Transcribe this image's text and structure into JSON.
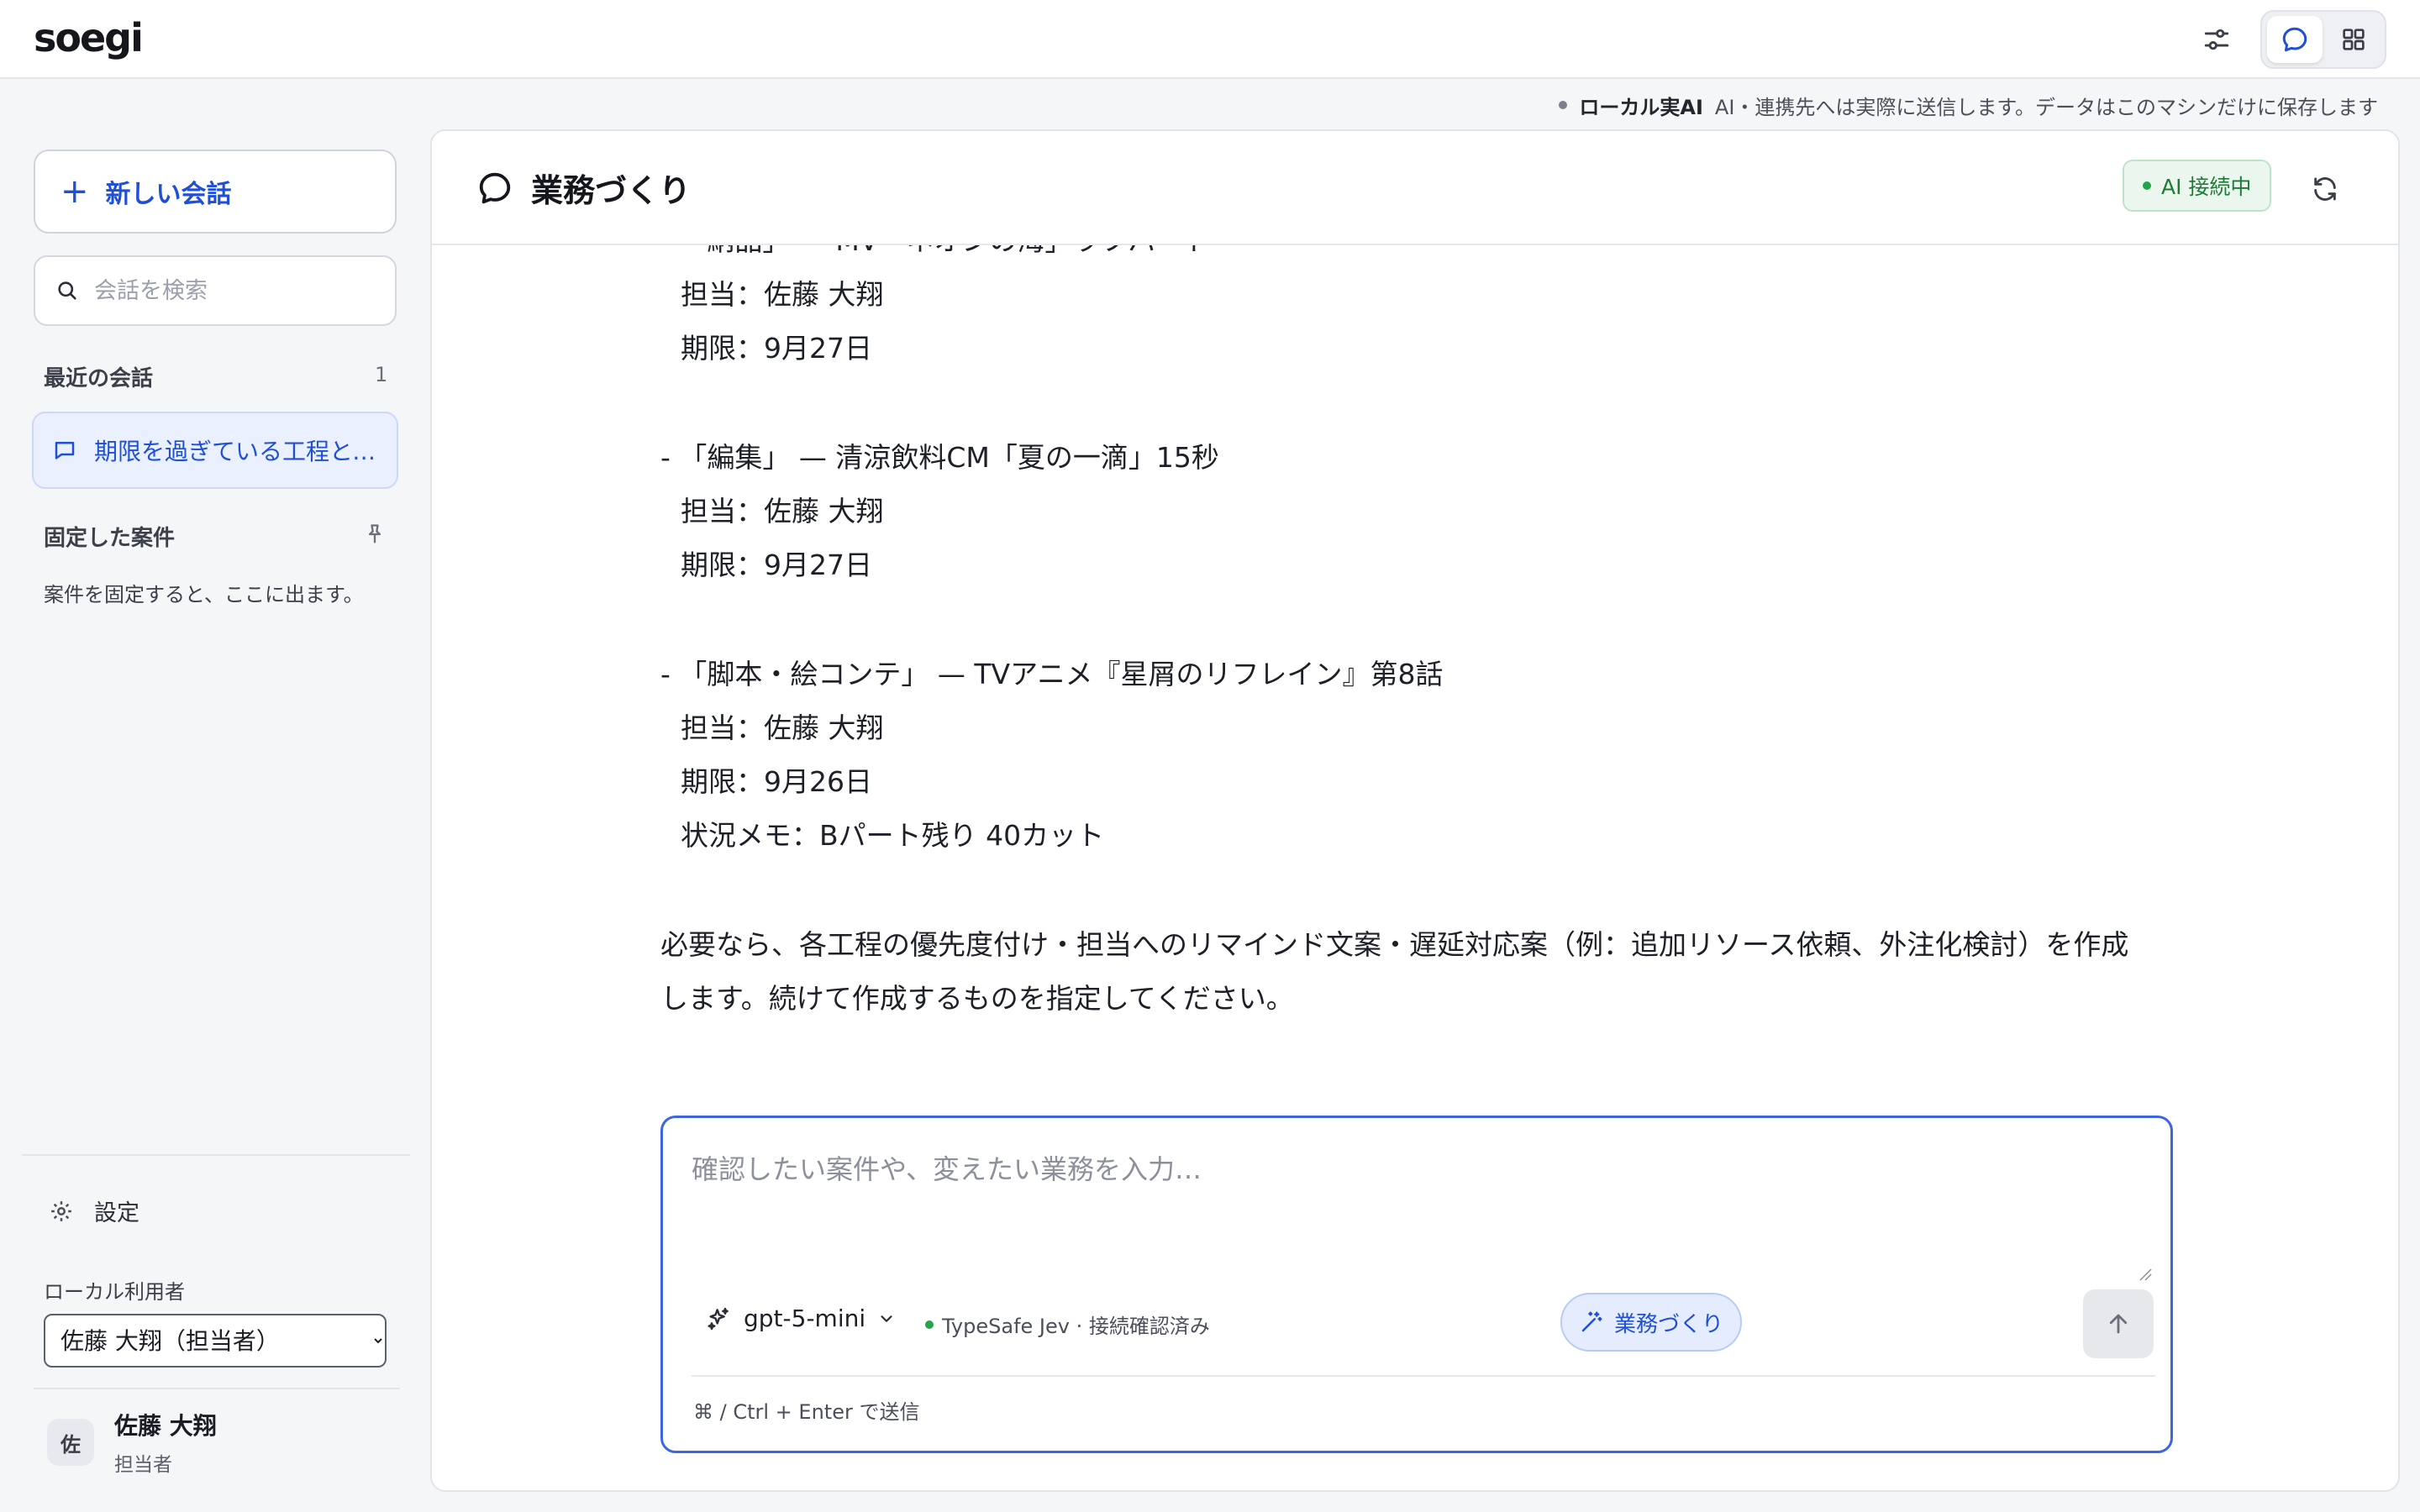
{
  "app": {
    "logo": "soegi"
  },
  "topbar": {
    "settings_icon": "sliders-icon",
    "view_chat_icon": "chat-bubble-icon",
    "view_grid_icon": "grid-icon"
  },
  "notice": {
    "strong": "ローカル実AI",
    "text": "AI・連携先へは実際に送信します。データはこのマシンだけに保存します"
  },
  "sidebar": {
    "new_chat_label": "新しい会話",
    "search_placeholder": "会話を検索",
    "recent_label": "最近の会話",
    "recent_count": "1",
    "recent_items": [
      {
        "label": "期限を過ぎている工程とその担当を教えて"
      }
    ],
    "pinned_label": "固定した案件",
    "pinned_empty": "案件を固定すると、ここに出ます。",
    "settings_label": "設定",
    "local_user_label": "ローカル利用者",
    "local_user_selected": "佐藤 大翔（担当者）",
    "profile": {
      "avatar": "佐",
      "name": "佐藤 大翔",
      "role": "担当者"
    }
  },
  "main": {
    "title": "業務づくり",
    "ai_status": "AI 接続中",
    "messages": [
      {
        "text": "- 「納品」 — MV「ネオンの海」ラフパート",
        "indent": false
      },
      {
        "text": "担当：佐藤 大翔",
        "indent": true
      },
      {
        "text": "期限：9月27日",
        "indent": true
      },
      {
        "text": "- 「編集」 — 清涼飲料CM「夏の一滴」15秒",
        "indent": false
      },
      {
        "text": "担当：佐藤 大翔",
        "indent": true
      },
      {
        "text": "期限：9月27日",
        "indent": true
      },
      {
        "text": "- 「脚本・絵コンテ」 — TVアニメ『星屑のリフレイン』第8話",
        "indent": false
      },
      {
        "text": "担当：佐藤 大翔",
        "indent": true
      },
      {
        "text": "期限：9月26日",
        "indent": true
      },
      {
        "text": "状況メモ：Bパート残り 40カット",
        "indent": true
      },
      {
        "text": "必要なら、各工程の優先度付け・担当へのリマインド文案・遅延対応案（例：追加リソース依頼、外注化検討）を作成",
        "indent": false
      },
      {
        "text": "します。続けて作成するものを指定してください。",
        "indent": false
      }
    ]
  },
  "composer": {
    "placeholder": "確認したい案件や、変えたい業務を入力…",
    "model": "gpt-5-mini",
    "connection": "TypeSafe Jev · 接続確認済み",
    "mode_chip": "業務づくり",
    "hint": "⌘ / Ctrl + Enter で送信"
  },
  "colors": {
    "accent": "#1f4fd6",
    "composer_border": "#3b66e0",
    "status_green": "#22a548"
  }
}
